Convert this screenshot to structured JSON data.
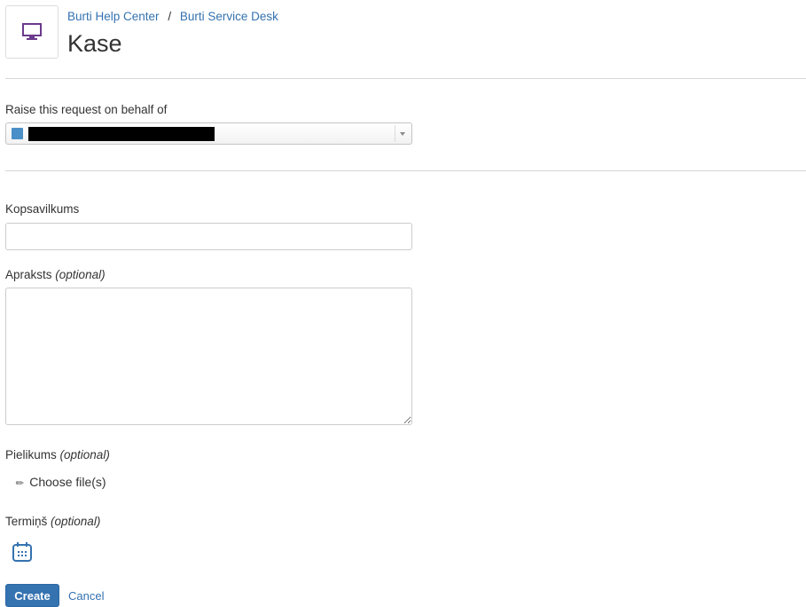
{
  "header": {
    "breadcrumb": [
      "Burti Help Center",
      "Burti Service Desk"
    ],
    "breadcrumb_separator": "/",
    "title": "Kase",
    "icon": "monitor-icon",
    "icon_color": "#6b3a8c"
  },
  "on_behalf": {
    "label": "Raise this request on behalf of",
    "value": "[redacted]",
    "icon": "user-icon"
  },
  "fields": {
    "summary": {
      "label": "Kopsavilkums",
      "value": ""
    },
    "description": {
      "label": "Apraksts",
      "optional": "(optional)",
      "value": ""
    },
    "attachment": {
      "label": "Pielikums",
      "optional": "(optional)",
      "action": "Choose file(s)",
      "icon": "paperclip-icon"
    },
    "due": {
      "label": "Termiņš",
      "optional": "(optional)",
      "icon": "calendar-icon"
    }
  },
  "actions": {
    "create": "Create",
    "cancel": "Cancel"
  },
  "colors": {
    "link": "#3572b0",
    "primary_button": "#3572b0",
    "divider": "#d6d6d6"
  }
}
